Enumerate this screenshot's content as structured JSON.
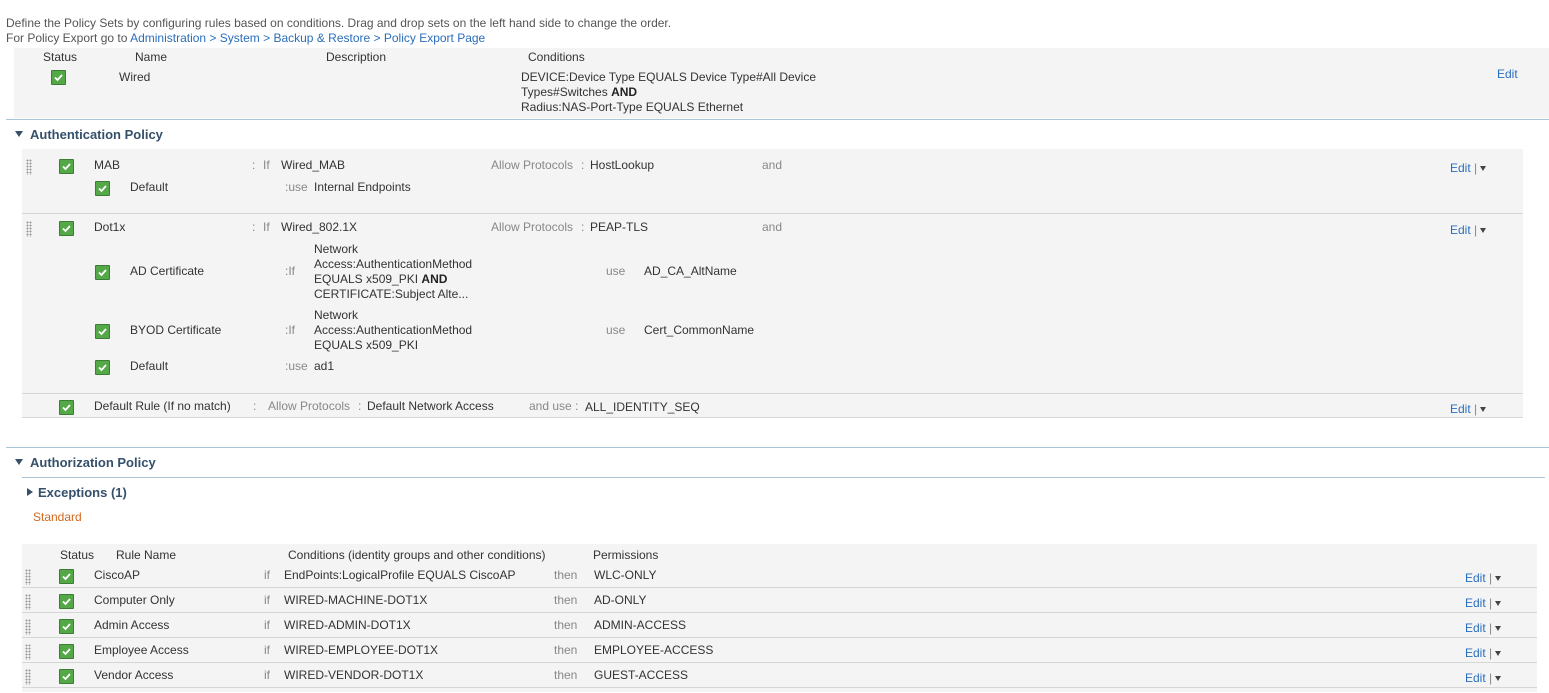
{
  "intro": {
    "line1": "Define the Policy Sets by configuring rules based on conditions. Drag and drop sets on the left hand side to change the order.",
    "line2_prefix": "For Policy Export go to",
    "line2_link": "Administration > System > Backup & Restore > Policy Export Page"
  },
  "policy_set": {
    "headers": {
      "status": "Status",
      "name": "Name",
      "description": "Description",
      "conditions": "Conditions"
    },
    "name": "Wired",
    "cond_line1": "DEVICE:Device Type EQUALS Device Type#All Device",
    "cond_line2": "Types#Switches",
    "cond_and": "AND",
    "cond_line3": "Radius:NAS-Port-Type EQUALS Ethernet",
    "edit": "Edit"
  },
  "authentication": {
    "title": "Authentication Policy",
    "mab": {
      "name": "MAB",
      "colon": ":",
      "if": "If",
      "condition": "Wired_MAB",
      "allow": "Allow Protocols",
      "sep": ":",
      "protocol": "HostLookup",
      "and": "and",
      "default_name": "Default",
      "use_label": ":use",
      "default_store": "Internal Endpoints",
      "edit": "Edit",
      "pipe": "|"
    },
    "dot1x": {
      "name": "Dot1x",
      "colon": ":",
      "if": "If",
      "condition": "Wired_802.1X",
      "allow": "Allow Protocols",
      "sep": ":",
      "protocol": "PEAP-TLS",
      "and": "and",
      "edit": "Edit",
      "pipe": "|",
      "ad": {
        "name": "AD Certificate",
        "if": ":If",
        "c1": "Network",
        "c2": "Access:AuthenticationMethod",
        "c3": "EQUALS x509_PKI",
        "c3and": "AND",
        "c4": "CERTIFICATE:Subject Alte...",
        "use": "use",
        "store": "AD_CA_AltName"
      },
      "byod": {
        "name": "BYOD Certificate",
        "if": ":If",
        "c1": "Network",
        "c2": "Access:AuthenticationMethod",
        "c3": "EQUALS x509_PKI",
        "use": "use",
        "store": "Cert_CommonName"
      },
      "default": {
        "name": "Default",
        "use": ":use",
        "store": "ad1"
      }
    },
    "default_rule": {
      "name": "Default Rule (If no match)",
      "colon": ":",
      "allow": "Allow Protocols",
      "sep": ":",
      "protocol": "Default Network Access",
      "and_use": "and use :",
      "store": "ALL_IDENTITY_SEQ",
      "edit": "Edit",
      "pipe": "|"
    }
  },
  "authorization": {
    "title": "Authorization Policy",
    "exceptions": "Exceptions (1)",
    "standard": "Standard",
    "headers": {
      "status": "Status",
      "rule": "Rule Name",
      "conditions": "Conditions (identity groups and other conditions)",
      "permissions": "Permissions"
    },
    "rows": [
      {
        "name": "CiscoAP",
        "if": "if",
        "condition": "EndPoints:LogicalProfile EQUALS CiscoAP",
        "then": "then",
        "permission": "WLC-ONLY",
        "edit": "Edit",
        "pipe": "|"
      },
      {
        "name": "Computer Only",
        "if": "if",
        "condition": "WIRED-MACHINE-DOT1X",
        "then": "then",
        "permission": "AD-ONLY",
        "edit": "Edit",
        "pipe": "|"
      },
      {
        "name": "Admin Access",
        "if": "if",
        "condition": "WIRED-ADMIN-DOT1X",
        "then": "then",
        "permission": "ADMIN-ACCESS",
        "edit": "Edit",
        "pipe": "|"
      },
      {
        "name": "Employee Access",
        "if": "if",
        "condition": "WIRED-EMPLOYEE-DOT1X",
        "then": "then",
        "permission": "EMPLOYEE-ACCESS",
        "edit": "Edit",
        "pipe": "|"
      },
      {
        "name": "Vendor Access",
        "if": "if",
        "condition": "WIRED-VENDOR-DOT1X",
        "then": "then",
        "permission": "GUEST-ACCESS",
        "edit": "Edit",
        "pipe": "|"
      }
    ]
  }
}
